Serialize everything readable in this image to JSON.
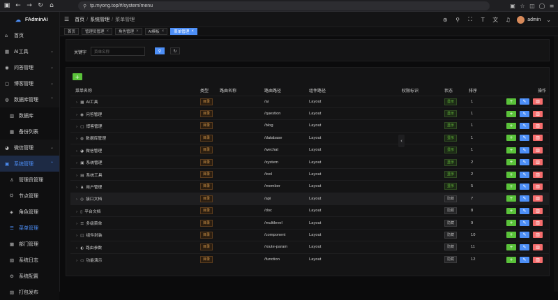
{
  "browser": {
    "url": "tp.myong.top/#/system/menu"
  },
  "sidebar": {
    "logo": "FAdminAi",
    "items": [
      {
        "label": "首页",
        "icon": "home-icon",
        "glyph": "⌂"
      },
      {
        "label": "AI工具",
        "icon": "ai-icon",
        "glyph": "▢"
      },
      {
        "label": "问答管理",
        "icon": "question-icon",
        "glyph": "◯"
      },
      {
        "label": "博客管理",
        "icon": "blog-icon",
        "glyph": "▤"
      },
      {
        "label": "数据库管理",
        "icon": "database-icon",
        "glyph": "◍"
      },
      {
        "label": "数据库",
        "icon": "db-icon",
        "glyph": "▥"
      },
      {
        "label": "备份列表",
        "icon": "backup-icon",
        "glyph": "▦"
      },
      {
        "label": "微信管理",
        "icon": "wechat-icon",
        "glyph": "◕"
      },
      {
        "label": "系统管理",
        "icon": "system-icon",
        "glyph": "▣"
      },
      {
        "label": "管理员管理",
        "icon": "user-icon",
        "glyph": "♙"
      },
      {
        "label": "节点管理",
        "icon": "node-icon",
        "glyph": "⛭"
      },
      {
        "label": "角色管理",
        "icon": "role-icon",
        "glyph": "◈"
      },
      {
        "label": "菜单管理",
        "icon": "menu-icon",
        "glyph": "☰"
      },
      {
        "label": "部门管理",
        "icon": "dept-icon",
        "glyph": "▩"
      },
      {
        "label": "系统日志",
        "icon": "log-icon",
        "glyph": "▧"
      },
      {
        "label": "系统配置",
        "icon": "config-icon",
        "glyph": "⚙"
      },
      {
        "label": "打包发布",
        "icon": "package-icon",
        "glyph": "▨"
      }
    ]
  },
  "header": {
    "breadcrumb": [
      "首页",
      "系统管理",
      "菜单管理"
    ],
    "username": "admin"
  },
  "tabs": [
    {
      "label": "首页",
      "closable": false,
      "active": false
    },
    {
      "label": "管理员管理",
      "closable": true,
      "active": false
    },
    {
      "label": "角色管理",
      "closable": true,
      "active": false
    },
    {
      "label": "AI模板",
      "closable": true,
      "active": false
    },
    {
      "label": "菜单管理",
      "closable": true,
      "active": true
    }
  ],
  "search": {
    "label": "关键字",
    "placeholder": "菜单名称"
  },
  "table": {
    "headers": [
      "菜单名称",
      "类型",
      "路由名称",
      "路由路径",
      "组件路径",
      "权限标识",
      "状态",
      "排序",
      "操作"
    ],
    "rows": [
      {
        "name": "AI工具",
        "icon": "▦",
        "type": "目录",
        "path": "/ai",
        "component": "Layout",
        "status": "显示",
        "on": true,
        "sort": "1"
      },
      {
        "name": "问答管理",
        "icon": "◉",
        "type": "目录",
        "path": "/question",
        "component": "Layout",
        "status": "显示",
        "on": true,
        "sort": "1"
      },
      {
        "name": "博客管理",
        "icon": "▢",
        "type": "目录",
        "path": "/blog",
        "component": "Layout",
        "status": "显示",
        "on": true,
        "sort": "1"
      },
      {
        "name": "数据库管理",
        "icon": "◍",
        "type": "目录",
        "path": "/database",
        "component": "Layout",
        "status": "显示",
        "on": true,
        "sort": "1"
      },
      {
        "name": "微信管理",
        "icon": "◕",
        "type": "目录",
        "path": "/wechat",
        "component": "Layout",
        "status": "显示",
        "on": true,
        "sort": "1"
      },
      {
        "name": "系统管理",
        "icon": "▣",
        "type": "目录",
        "path": "/system",
        "component": "Layout",
        "status": "显示",
        "on": true,
        "sort": "2"
      },
      {
        "name": "系统工具",
        "icon": "▤",
        "type": "目录",
        "path": "/tool",
        "component": "Layout",
        "status": "显示",
        "on": true,
        "sort": "2"
      },
      {
        "name": "用户管理",
        "icon": "♟",
        "type": "目录",
        "path": "/member",
        "component": "Layout",
        "status": "显示",
        "on": true,
        "sort": "5"
      },
      {
        "name": "接口文档",
        "icon": "◎",
        "type": "目录",
        "path": "/api",
        "component": "Layout",
        "status": "隐藏",
        "on": false,
        "sort": "7"
      },
      {
        "name": "平台文档",
        "icon": "▯",
        "type": "目录",
        "path": "/doc",
        "component": "Layout",
        "status": "隐藏",
        "on": false,
        "sort": "8"
      },
      {
        "name": "多级菜单",
        "icon": "☰",
        "type": "目录",
        "path": "/multilevel",
        "component": "Layout",
        "status": "隐藏",
        "on": false,
        "sort": "9"
      },
      {
        "name": "组件封装",
        "icon": "◫",
        "type": "目录",
        "path": "/component",
        "component": "Layout",
        "status": "隐藏",
        "on": false,
        "sort": "10"
      },
      {
        "name": "路由参数",
        "icon": "◐",
        "type": "目录",
        "path": "/route-param",
        "component": "Layout",
        "status": "隐藏",
        "on": false,
        "sort": "11"
      },
      {
        "name": "功能演示",
        "icon": "▭",
        "type": "目录",
        "path": "/function",
        "component": "Layout",
        "status": "隐藏",
        "on": false,
        "sort": "12"
      }
    ]
  },
  "colors": {
    "accent": "#4d8ff7",
    "success": "#5ac23a",
    "danger": "#f56c6c",
    "warning": "#d89a4a"
  }
}
